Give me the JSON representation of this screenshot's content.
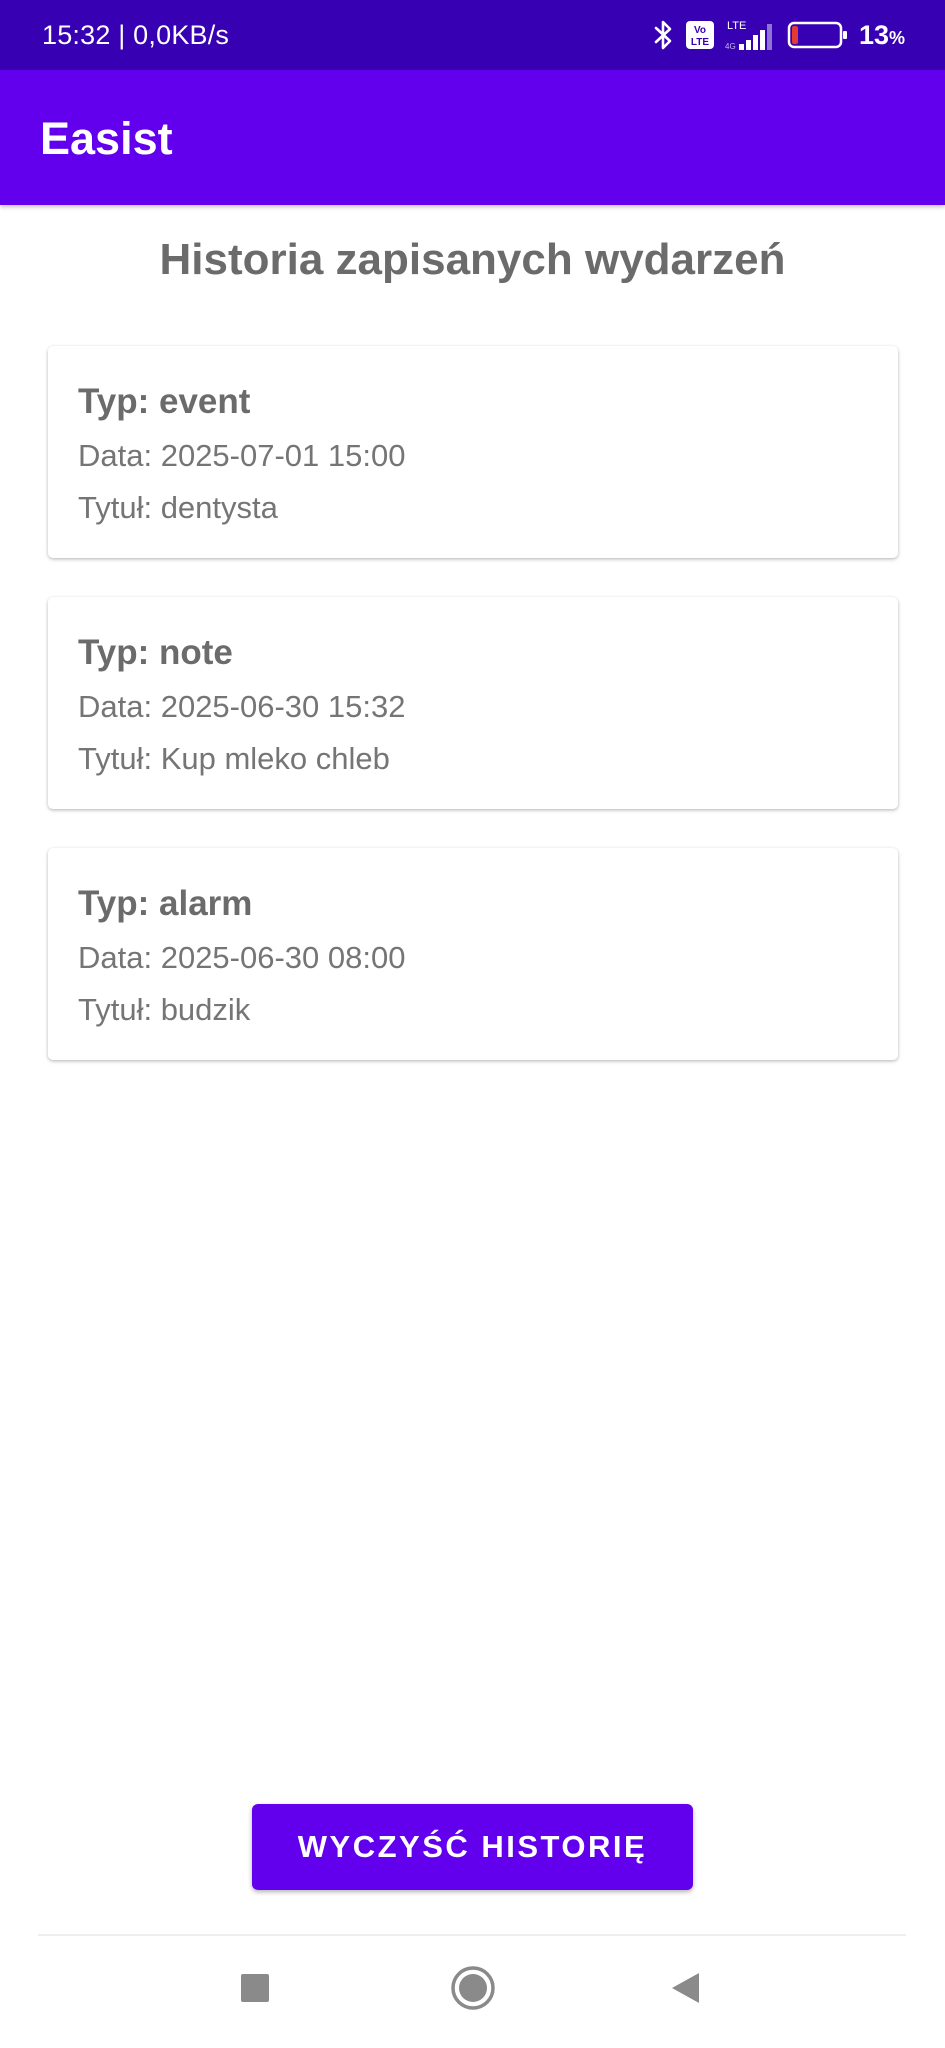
{
  "status_bar": {
    "time_speed": "15:32 | 0,0KB/s",
    "volte_label": "Vo LTE",
    "network_label": "LTE",
    "battery_value": "13",
    "battery_unit": "%",
    "battery_level": 0.13
  },
  "app_bar": {
    "title": "Easist"
  },
  "page": {
    "title": "Historia zapisanych wydarzeń"
  },
  "events": [
    {
      "type": "Typ: event",
      "date": "Data: 2025-07-01 15:00",
      "title": "Tytuł: dentysta"
    },
    {
      "type": "Typ: note",
      "date": "Data: 2025-06-30 15:32",
      "title": "Tytuł: Kup mleko chleb"
    },
    {
      "type": "Typ: alarm",
      "date": "Data: 2025-06-30 08:00",
      "title": "Tytuł: budzik"
    }
  ],
  "actions": {
    "clear_label": "WYCZYŚĆ HISTORIĘ"
  },
  "nav": {
    "recents_icon": "square-icon",
    "home_icon": "circle-icon",
    "back_icon": "triangle-back-icon"
  },
  "colors": {
    "status_bar": "#3700b3",
    "app_bar": "#6200ee",
    "accent": "#6200ee",
    "battery_low": "#e53935"
  }
}
